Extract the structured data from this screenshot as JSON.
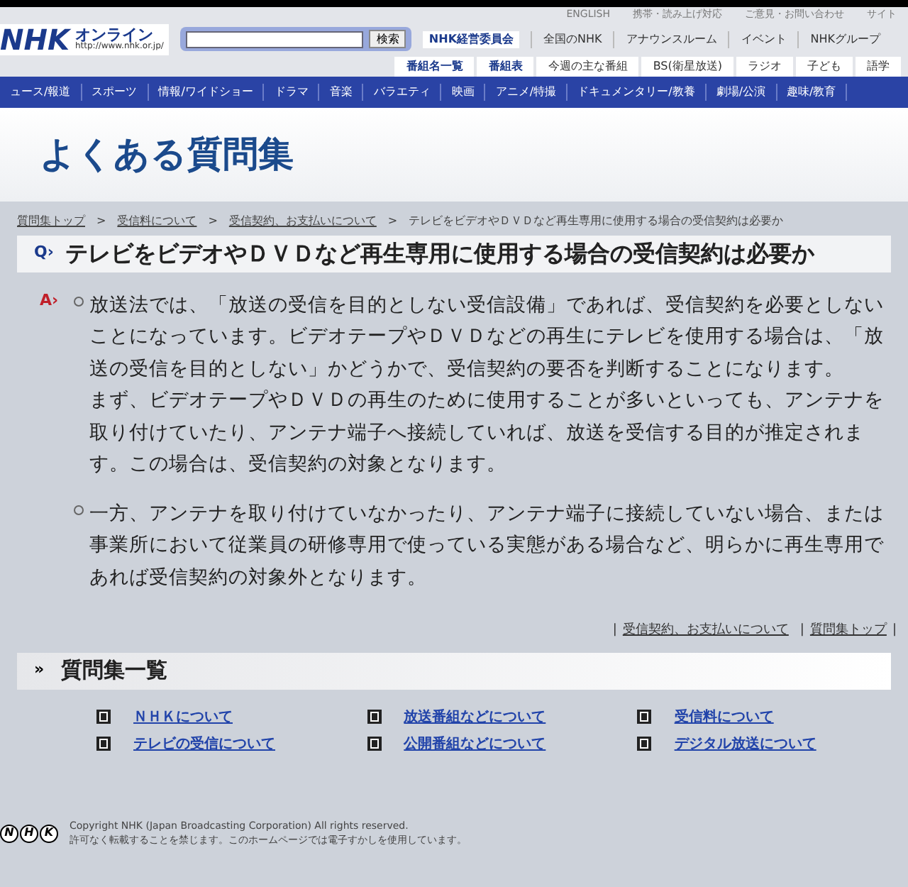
{
  "header": {
    "logo": "NHK",
    "logo_sub": "オンライン",
    "url": "http://www.nhk.or.jp/",
    "utility_links": [
      "ENGLISH",
      "携帯・読み上げ対応",
      "ご意見・お問い合わせ",
      "サイト"
    ],
    "search": {
      "button": "検索"
    },
    "committee": "NHK経営委員会",
    "top_links": [
      "全国のNHK",
      "アナウンスルーム",
      "イベント",
      "NHKグループ"
    ],
    "program_tabs": [
      {
        "label": "番組名一覧",
        "kind": "blue"
      },
      {
        "label": "番組表",
        "kind": "blue"
      },
      {
        "label": "今週の主な番組",
        "kind": "plain"
      },
      {
        "label": "BS(衛星放送)",
        "kind": "plain"
      },
      {
        "label": "ラジオ",
        "kind": "plain"
      },
      {
        "label": "子ども",
        "kind": "plain"
      },
      {
        "label": "語学",
        "kind": "plain"
      }
    ],
    "genres": [
      "ュース/報道",
      "スポーツ",
      "情報/ワイドショー",
      "ドラマ",
      "音楽",
      "バラエティ",
      "映画",
      "アニメ/特撮",
      "ドキュメンタリー/教養",
      "劇場/公演",
      "趣味/教育"
    ]
  },
  "page_title": "よくある質問集",
  "breadcrumb_separator": ">",
  "link_separator": "|",
  "breadcrumb": [
    {
      "label": "質問集トップ",
      "link": true
    },
    {
      "label": "受信料について",
      "link": true
    },
    {
      "label": "受信契約、お支払いについて",
      "link": true
    },
    {
      "label": "テレビをビデオやＤＶＤなど再生専用に使用する場合の受信契約は必要か",
      "link": false
    }
  ],
  "question": {
    "mark": "Q›",
    "text": "テレビをビデオやＤＶＤなど再生専用に使用する場合の受信契約は必要か"
  },
  "answer": {
    "mark": "A›",
    "items": [
      [
        "放送法では、「放送の受信を目的としない受信設備」であれば、受信契約を必要としないことになっています。ビデオテープやＤＶＤなどの再生にテレビを使用する場合は、「放送の受信を目的としない」かどうかで、受信契約の要否を判断することになります。",
        "まず、ビデオテープやＤＶＤの再生のために使用することが多いといっても、アンテナを取り付けていたり、アンテナ端子へ接続していれば、放送を受信する目的が推定されます。この場合は、受信契約の対象となります。"
      ],
      [
        "一方、アンテナを取り付けていなかったり、アンテナ端子に接続していない場合、または事業所において従業員の研修専用で使っている実態がある場合など、明らかに再生専用であれば受信契約の対象外となります。"
      ]
    ]
  },
  "related_links": [
    "受信契約、お支払いについて",
    "質問集トップ"
  ],
  "faq_index": {
    "mark": "»",
    "title": "質問集一覧",
    "items": [
      "ＮＨＫについて",
      "放送番組などについて",
      "受信料について",
      "テレビの受信について",
      "公開番組などについて",
      "デジタル放送について"
    ]
  },
  "footer": {
    "logo": [
      "N",
      "H",
      "K"
    ],
    "lines": [
      "Copyright NHK (Japan Broadcasting Corporation) All rights reserved.",
      "許可なく転載することを禁じます。このホームページでは電子すかしを使用しています。"
    ]
  }
}
